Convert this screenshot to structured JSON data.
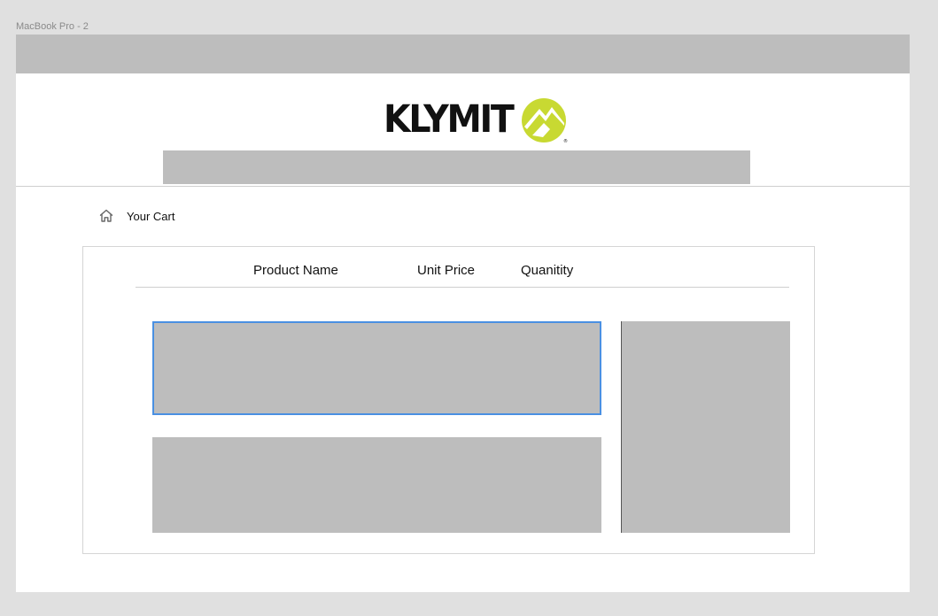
{
  "frame": {
    "label": "MacBook Pro - 2"
  },
  "header": {
    "logo_text": "KLYMIT",
    "logo_icon": "klymit-mountain-logo",
    "brand_color": "#c8d932"
  },
  "breadcrumb": {
    "icon": "home-icon",
    "label": "Your Cart"
  },
  "cart": {
    "columns": [
      "Product Name",
      "Unit Price",
      "Quanitity"
    ]
  },
  "colors": {
    "placeholder": "#bdbdbd",
    "selection": "#4a90e2",
    "canvas": "#e0e0e0"
  }
}
